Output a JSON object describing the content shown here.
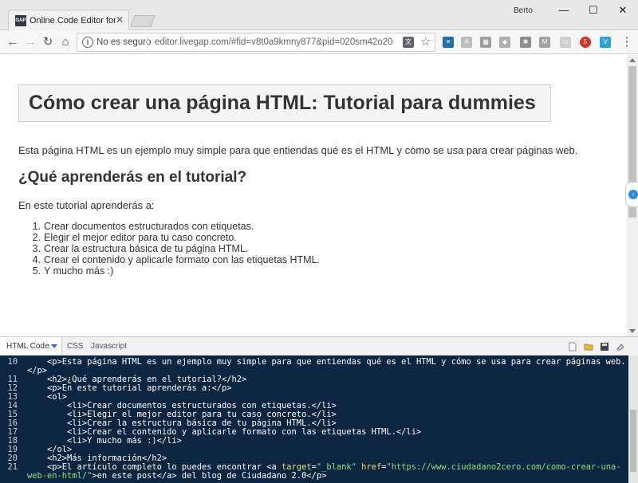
{
  "browser": {
    "tab_title": "Online Code Editor for H",
    "favicon_text": "GAP",
    "user_name": "Berto",
    "omnibox": {
      "security_text": "No es seguro",
      "url": "editor.livegap.com/#fid=v8t0a9kmny877&pid=020sm42o20..."
    },
    "extension_badge": "5"
  },
  "preview": {
    "title": "Cómo crear una página HTML: Tutorial para dummies",
    "intro": "Esta página HTML es un ejemplo muy simple para que entiendas qué es el HTML y cómo se usa para crear páginas web.",
    "subheading": "¿Qué aprenderás en el tutorial?",
    "lead": "En este tutorial aprenderás a:",
    "steps": [
      {
        "num": "1.",
        "text": "Crear documentos estructurados con etiquetas."
      },
      {
        "num": "2.",
        "text": "Elegir el mejor editor para tu caso concreto."
      },
      {
        "num": "3.",
        "text": "Crear la estructura básica de tu página HTML."
      },
      {
        "num": "4.",
        "text": "Crear el contenido y aplicarle formato con las etiquetas HTML."
      },
      {
        "num": "5.",
        "text": "Y mucho más :)"
      }
    ]
  },
  "code_tabs": {
    "html": "HTML Code",
    "css": "CSS",
    "js": "Javascript"
  },
  "code": {
    "lines": [
      {
        "num": "10",
        "parts": [
          {
            "t": "    <p>Esta página HTML es un ejemplo muy simple para que entiendas qué es el HTML y cómo se usa para crear páginas web.",
            "c": "tag"
          }
        ]
      },
      {
        "num": "",
        "parts": [
          {
            "t": "</p>",
            "c": "tag"
          }
        ]
      },
      {
        "num": "11",
        "parts": [
          {
            "t": "    <h2>¿Qué aprenderás en el tutorial?</h2>",
            "c": "tag"
          }
        ]
      },
      {
        "num": "12",
        "parts": [
          {
            "t": "    <p>En este tutorial aprenderás a:</p>",
            "c": "tag"
          }
        ]
      },
      {
        "num": "13",
        "parts": [
          {
            "t": "    <ol>",
            "c": "tag"
          }
        ]
      },
      {
        "num": "14",
        "parts": [
          {
            "t": "        <li>Crear documentos estructurados con etiquetas.</li>",
            "c": "tag"
          }
        ]
      },
      {
        "num": "15",
        "parts": [
          {
            "t": "        <li>Elegir el mejor editor para tu caso concreto.</li>",
            "c": "tag"
          }
        ]
      },
      {
        "num": "16",
        "parts": [
          {
            "t": "        <li>Crear la estructura básica de tu página HTML.</li>",
            "c": "tag"
          }
        ]
      },
      {
        "num": "17",
        "parts": [
          {
            "t": "        <li>Crear el contenido y aplicarle formato con las etiquetas HTML.</li>",
            "c": "tag"
          }
        ]
      },
      {
        "num": "18",
        "parts": [
          {
            "t": "        <li>Y mucho más :)</li>",
            "c": "tag"
          }
        ]
      },
      {
        "num": "19",
        "parts": [
          {
            "t": "    </ol>",
            "c": "tag"
          }
        ]
      },
      {
        "num": "20",
        "parts": [
          {
            "t": "    <h2>Más información</h2>",
            "c": "tag"
          }
        ]
      },
      {
        "num": "21",
        "parts": [
          {
            "t": "    <p>El artículo completo lo puedes encontrar <a ",
            "c": "tag"
          },
          {
            "t": "target",
            "c": "attr"
          },
          {
            "t": "=",
            "c": "tag"
          },
          {
            "t": "\"_blank\"",
            "c": "str"
          },
          {
            "t": " ",
            "c": "tag"
          },
          {
            "t": "href",
            "c": "attr"
          },
          {
            "t": "=",
            "c": "tag"
          },
          {
            "t": "\"https://www.ciudadano2cero.com/como-crear-una-",
            "c": "str"
          }
        ]
      },
      {
        "num": "",
        "parts": [
          {
            "t": "web-en-html/\"",
            "c": "str"
          },
          {
            "t": ">en este post</a> del blog de Ciudadano 2.0</p>",
            "c": "tag"
          }
        ]
      }
    ]
  }
}
